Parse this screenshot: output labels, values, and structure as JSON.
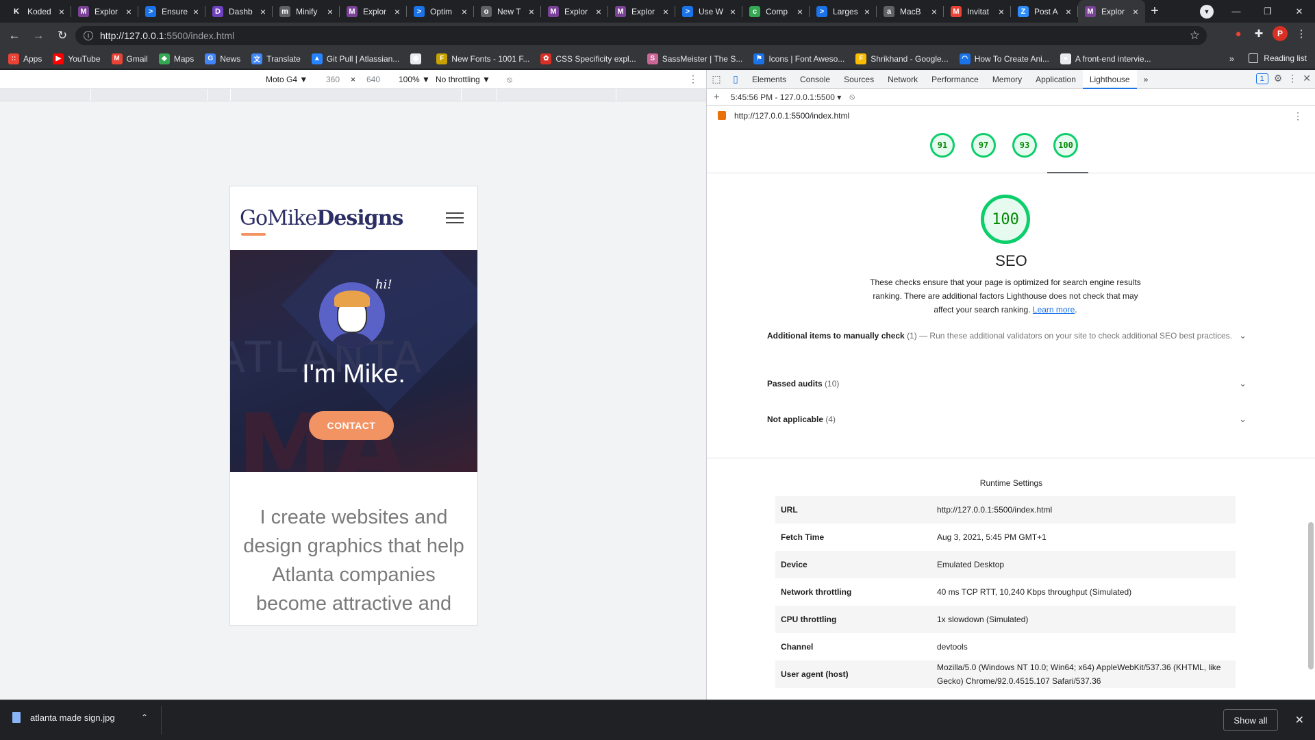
{
  "browser": {
    "tabs": [
      {
        "title": "Koded",
        "color": "#202124",
        "glyph": "K"
      },
      {
        "title": "Explor",
        "color": "#7b4397",
        "glyph": "M"
      },
      {
        "title": "Ensure",
        "color": "#1a73e8",
        "glyph": ">"
      },
      {
        "title": "Dashb",
        "color": "#6f42c1",
        "glyph": "D"
      },
      {
        "title": "Minify",
        "color": "#5f6368",
        "glyph": "m"
      },
      {
        "title": "Explor",
        "color": "#7b4397",
        "glyph": "M"
      },
      {
        "title": "Optim",
        "color": "#1a73e8",
        "glyph": ">"
      },
      {
        "title": "New T",
        "color": "#5f6368",
        "glyph": "o"
      },
      {
        "title": "Explor",
        "color": "#7b4397",
        "glyph": "M"
      },
      {
        "title": "Explor",
        "color": "#7b4397",
        "glyph": "M"
      },
      {
        "title": "Use W",
        "color": "#1a73e8",
        "glyph": ">"
      },
      {
        "title": "Comp",
        "color": "#34a853",
        "glyph": "c"
      },
      {
        "title": "Larges",
        "color": "#1a73e8",
        "glyph": ">"
      },
      {
        "title": "MacB",
        "color": "#5f6368",
        "glyph": "a"
      },
      {
        "title": "Invitat",
        "color": "#ea4335",
        "glyph": "M"
      },
      {
        "title": "Post A",
        "color": "#2d8cff",
        "glyph": "Z"
      },
      {
        "title": "Explor",
        "color": "#7b4397",
        "glyph": "M",
        "active": true
      }
    ],
    "new_tab_label": "+",
    "url_host": "http://127.0.0.1",
    "url_rest": ":5500/index.html",
    "profile_initial": "P",
    "bookmarks": [
      {
        "label": "Apps",
        "color": "#ea4335",
        "glyph": "::"
      },
      {
        "label": "YouTube",
        "color": "#ff0000",
        "glyph": "▶"
      },
      {
        "label": "Gmail",
        "color": "#ea4335",
        "glyph": "M"
      },
      {
        "label": "Maps",
        "color": "#34a853",
        "glyph": "◆"
      },
      {
        "label": "News",
        "color": "#4285f4",
        "glyph": "G"
      },
      {
        "label": "Translate",
        "color": "#4285f4",
        "glyph": "文"
      },
      {
        "label": "Git Pull | Atlassian...",
        "color": "#2684ff",
        "glyph": "▲"
      },
      {
        "label": "",
        "color": "#e8eaed",
        "glyph": "◉"
      },
      {
        "label": "New Fonts - 1001 F...",
        "color": "#c8a200",
        "glyph": "F"
      },
      {
        "label": "CSS Specificity expl...",
        "color": "#d93025",
        "glyph": "✿"
      },
      {
        "label": "SassMeister | The S...",
        "color": "#cc6699",
        "glyph": "S"
      },
      {
        "label": "Icons | Font Aweso...",
        "color": "#1a73e8",
        "glyph": "⚑"
      },
      {
        "label": "Shrikhand - Google...",
        "color": "#fbbc04",
        "glyph": "F"
      },
      {
        "label": "How To Create Ani...",
        "color": "#1a73e8",
        "glyph": "◠"
      },
      {
        "label": "A front-end intervie...",
        "color": "#e8eaed",
        "glyph": "●"
      }
    ],
    "bookmarks_more": "»",
    "reading_list": "Reading list"
  },
  "device_toolbar": {
    "device": "Moto G4 ▼",
    "width": "360",
    "times": "×",
    "height": "640",
    "zoom": "100% ▼",
    "throttling": "No throttling ▼"
  },
  "site": {
    "logo_go": "GoMike",
    "logo_designs": "Designs",
    "hi": "hi!",
    "hero_bg_text": "ATLANTA",
    "hero_bg_text2": "MA",
    "hero_title": "I'm Mike.",
    "contact_label": "CONTACT",
    "tagline": "I create websites and design graphics that help Atlanta companies become attractive and"
  },
  "devtools": {
    "tabs": [
      "Elements",
      "Console",
      "Sources",
      "Network",
      "Performance",
      "Memory",
      "Application",
      "Lighthouse"
    ],
    "active_tab": "Lighthouse",
    "more_tabs": "»",
    "issues_count": "1",
    "report_selector": "5:45:56 PM - 127.0.0.1:5500 ▾",
    "report_url": "http://127.0.0.1:5500/index.html",
    "scores": [
      "91",
      "97",
      "93",
      "100"
    ],
    "seo_score": "100",
    "category_title": "SEO",
    "category_desc": "These checks ensure that your page is optimized for search engine results ranking. There are additional factors Lighthouse does not check that may affect your search ranking.",
    "learn_more": "Learn more",
    "groups": [
      {
        "title": "Additional items to manually check",
        "count": "(1)",
        "desc": "— Run these additional validators on your site to check additional SEO best practices."
      },
      {
        "title": "Passed audits",
        "count": "(10)",
        "desc": ""
      },
      {
        "title": "Not applicable",
        "count": "(4)",
        "desc": ""
      }
    ],
    "runtime_title": "Runtime Settings",
    "runtime": [
      {
        "k": "URL",
        "v": "http://127.0.0.1:5500/index.html"
      },
      {
        "k": "Fetch Time",
        "v": "Aug 3, 2021, 5:45 PM GMT+1"
      },
      {
        "k": "Device",
        "v": "Emulated Desktop"
      },
      {
        "k": "Network throttling",
        "v": "40 ms TCP RTT, 10,240 Kbps throughput (Simulated)"
      },
      {
        "k": "CPU throttling",
        "v": "1x slowdown (Simulated)"
      },
      {
        "k": "Channel",
        "v": "devtools"
      },
      {
        "k": "User agent (host)",
        "v": "Mozilla/5.0 (Windows NT 10.0; Win64; x64) AppleWebKit/537.36 (KHTML, like Gecko) Chrome/92.0.4515.107 Safari/537.36"
      }
    ]
  },
  "downloads": {
    "file_name": "atlanta made sign.jpg",
    "show_all": "Show all"
  },
  "colors": {
    "accent_orange": "#f29363",
    "logo_navy": "#2b2f66",
    "score_green": "#0cce6b",
    "link_blue": "#1a73e8"
  }
}
